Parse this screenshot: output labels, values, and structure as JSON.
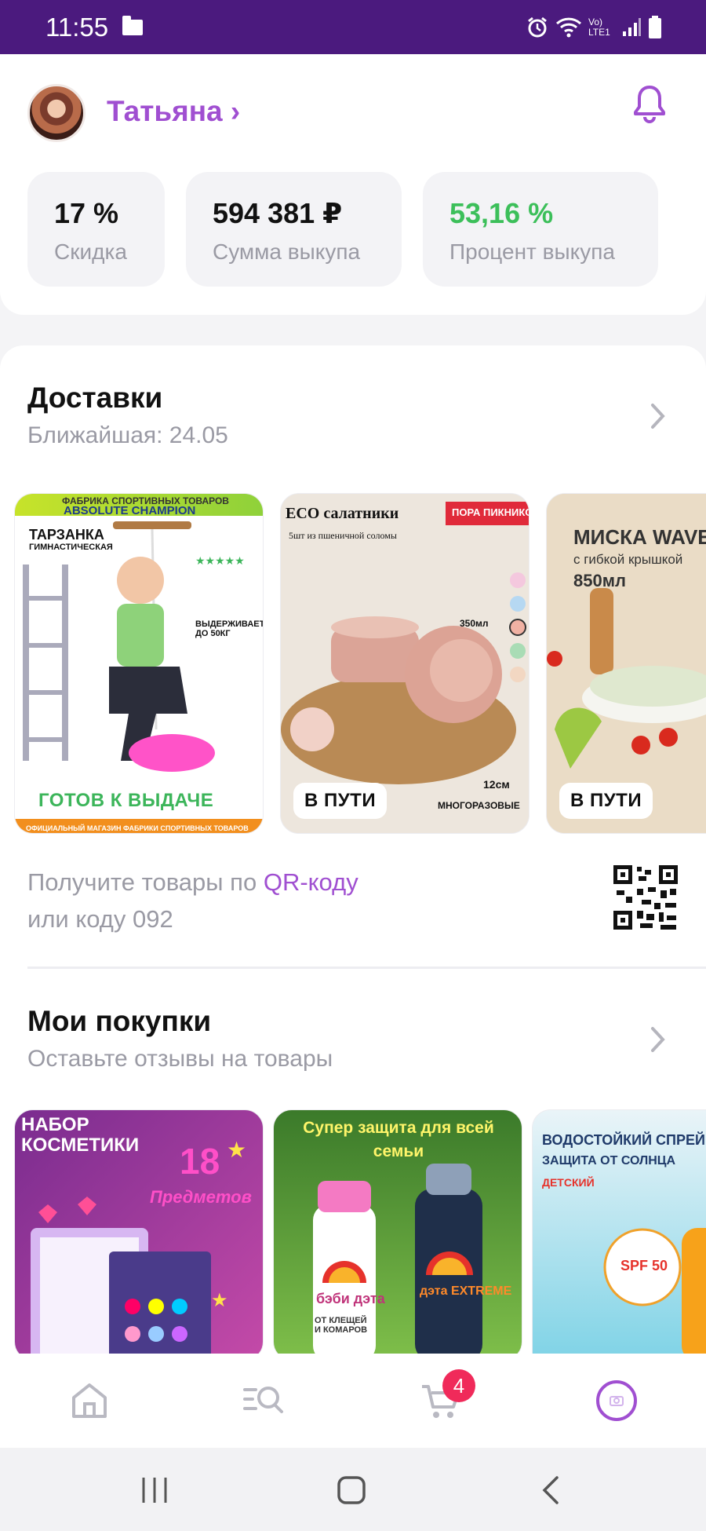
{
  "status_bar": {
    "time": "11:55",
    "network_label": "Vo) LTE1"
  },
  "profile": {
    "name": "Татьяна ›",
    "stats": [
      {
        "value": "17 %",
        "label": "Скидка",
        "color": "#111111"
      },
      {
        "value": "594 381 ₽",
        "label": "Сумма выкупа",
        "color": "#111111"
      },
      {
        "value": "53,16 %",
        "label": "Процент выкупа",
        "color": "#3cbf5a"
      }
    ]
  },
  "deliveries": {
    "title": "Доставки",
    "subtitle": "Ближайшая: 24.05",
    "items": [
      {
        "status": "ГОТОВ К ВЫДАЧЕ",
        "top_text": "ФАБРИКА СПОРТИВНЫХ ТОВАРОВ",
        "brand": "ABSOLUTE CHAMPION",
        "name": "ТАРЗАНКА",
        "name2": "ГИМНАСТИЧЕСКАЯ",
        "note": "ВЫДЕРЖИВАЕТ ДО 50КГ",
        "footer": "ОФИЦИАЛЬНЫЙ МАГАЗИН ФАБРИКИ СПОРТИВНЫХ ТОВАРОВ"
      },
      {
        "status": "В ПУТИ",
        "name": "ECO салатники",
        "tag": "ПОРА ПИКНИКОВ",
        "note": "5шт из пшеничной соломы",
        "size": "350мл",
        "dim": "12см",
        "footer": "МНОГОРАЗОВЫЕ"
      },
      {
        "status": "В ПУТИ",
        "name": "МИСКА WAVE",
        "sub": "с гибкой крышкой",
        "volume": "850мл"
      }
    ],
    "qr_text_before": "Получите товары по ",
    "qr_link": "QR-коду",
    "qr_text_after": "или коду 092"
  },
  "purchases": {
    "title": "Мои покупки",
    "subtitle": "Оставьте отзывы на товары",
    "items": [
      {
        "title": "НАБОР КОСМЕТИКИ",
        "count": "18",
        "count_label": "Предметов"
      },
      {
        "title": "Супер защита для всей семьи",
        "brand1": "бэби дэта",
        "brand2": "дэта EXTREME",
        "note": "ОТ КЛЕЩЕЙ И КОМАРОВ"
      },
      {
        "title": "ВОДОСТОЙКИЙ СПРЕЙ",
        "sub": "ЗАЩИТА ОТ СОЛНЦА",
        "kids": "ДЕТСКИЙ",
        "spf": "SPF 50"
      }
    ]
  },
  "nav": {
    "cart_count": "4"
  },
  "colors": {
    "accent": "#a04fd1",
    "status_bar": "#4b1a7e",
    "success": "#3cbf5a",
    "badge": "#f02a5a"
  }
}
